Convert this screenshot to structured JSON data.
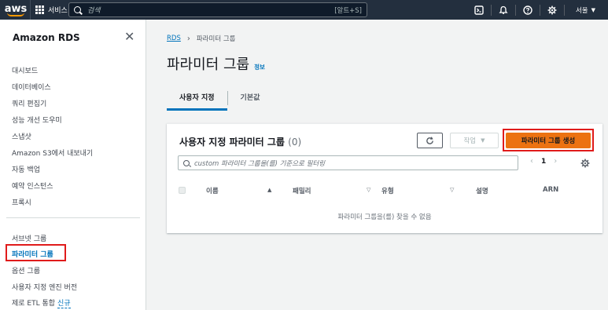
{
  "topbar": {
    "logo_text": "aws",
    "services_label": "서비스",
    "search_placeholder": "검색",
    "search_shortcut": "[알트+S]",
    "region_label": "서울",
    "icons": [
      "cloudshell-icon",
      "bell-icon",
      "help-icon",
      "settings-icon"
    ]
  },
  "sidebar": {
    "title": "Amazon RDS",
    "items_top": [
      "대시보드",
      "데이터베이스",
      "쿼리 편집기",
      "성능 개선 도우미",
      "스냅샷",
      "Amazon S3에서 내보내기",
      "자동 백업",
      "예약 인스턴스",
      "프록시"
    ],
    "items_bottom": [
      "서브넷 그룹",
      "파라미터 그룹",
      "옵션 그룹",
      "사용자 지정 엔진 버전",
      "제로 ETL 통합"
    ],
    "active_item": "파라미터 그룹",
    "new_badge": "신규"
  },
  "breadcrumb": {
    "root": "RDS",
    "current": "파라미터 그룹"
  },
  "page": {
    "title": "파라미터 그룹",
    "info_link": "정보"
  },
  "tabs": [
    "사용자 지정",
    "기본값"
  ],
  "panel": {
    "title": "사용자 지정 파라미터 그룹",
    "count": "(0)",
    "actions_label": "작업",
    "create_label": "파라미터 그룹 생성",
    "filter_placeholder": "custom 파라미터 그룹을(를) 기준으로 필터링",
    "page_number": "1",
    "columns": [
      "이름",
      "패밀리",
      "유형",
      "설명",
      "ARN"
    ],
    "empty_message": "파라미터 그룹을(를) 찾을 수 없음"
  },
  "colors": {
    "accent": "#0073bb",
    "primary_button": "#ec7211",
    "highlight": "#e01b1b",
    "topbar": "#232f3e"
  }
}
